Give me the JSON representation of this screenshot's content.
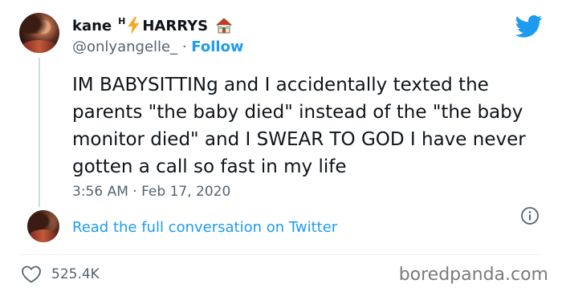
{
  "tweet": {
    "author": {
      "name_prefix": "kane",
      "name_sup": "H",
      "name_suffix": "HARRYS",
      "handle": "@onlyangelle_",
      "separator": "·",
      "follow_label": "Follow"
    },
    "text": "IM BABYSITTINg and I accidentally texted the parents \"the baby died\" instead of the \"the baby monitor died\" and I SWEAR TO GOD I have never gotten a call so fast in my life",
    "timestamp": "3:56 AM · Feb 17, 2020",
    "read_more_label": "Read the full conversation on Twitter",
    "likes": "525.4K"
  },
  "watermark": "boredpanda.com",
  "icons": {
    "brand": "twitter-bird-icon",
    "bolt": "lightning-bolt-icon",
    "house": "house-icon",
    "info": "info-icon",
    "like": "heart-icon"
  },
  "colors": {
    "accent": "#1d9bf0",
    "text": "#0f1419",
    "muted": "#536471",
    "bolt": "#f5a623",
    "watermark": "#7a7a7a"
  }
}
